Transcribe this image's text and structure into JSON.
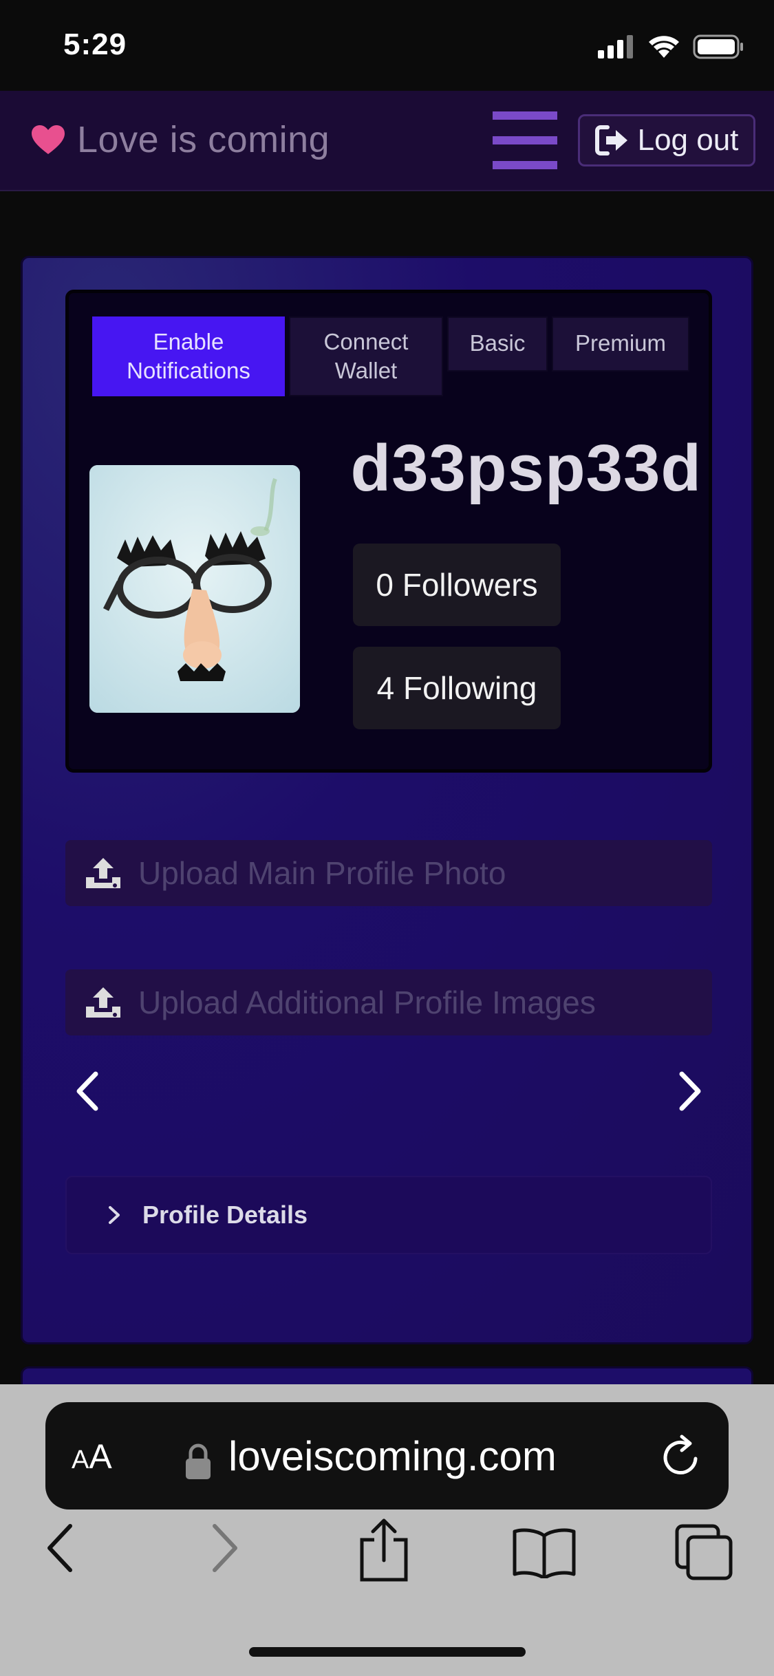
{
  "status_bar": {
    "time": "5:29",
    "icons": [
      "cellular-signal-icon",
      "wifi-icon",
      "battery-icon"
    ]
  },
  "header": {
    "brand_icon": "heart-icon",
    "brand_title": "Love is coming",
    "menu_icon": "hamburger-menu-icon",
    "logout_label": "Log out",
    "logout_icon": "sign-out-icon"
  },
  "profile": {
    "tabs": [
      {
        "line1": "Enable",
        "line2": "Notifications",
        "active": true
      },
      {
        "line1": "Connect",
        "line2": "Wallet",
        "active": false
      },
      {
        "line1": "Basic",
        "line2": "",
        "active": false
      },
      {
        "line1": "Premium",
        "line2": "",
        "active": false
      }
    ],
    "username": "d33psp33d",
    "followers_label": "0 Followers",
    "following_label": "4 Following",
    "avatar_desc": "novelty glasses with nose and mustache"
  },
  "uploads": {
    "main_photo_label": "Upload Main Profile Photo",
    "additional_images_label": "Upload Additional Profile Images"
  },
  "details": {
    "label": "Profile Details"
  },
  "browser": {
    "text_size_label_big": "A",
    "text_size_label_small": "A",
    "url": "loveiscoming.com"
  },
  "colors": {
    "accent": "#4716f2",
    "brand_pink": "#e8508f",
    "header_bg": "#1b0b35",
    "card_bg": "#1d0d69"
  }
}
